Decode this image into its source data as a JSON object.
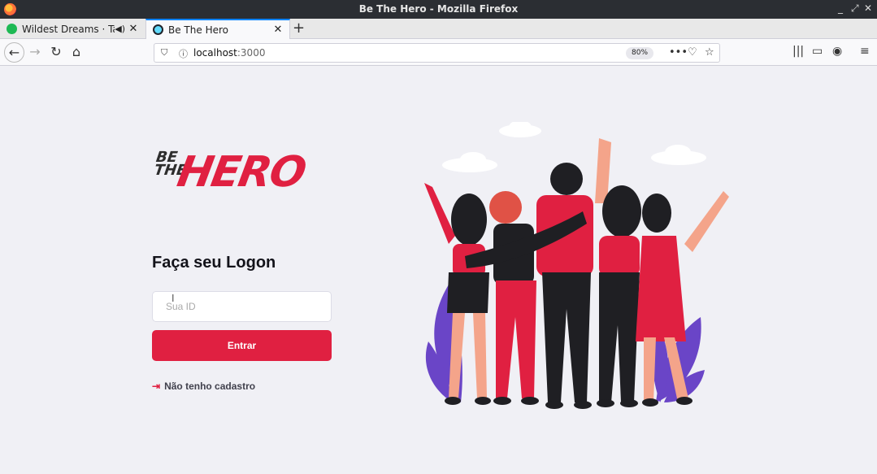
{
  "window": {
    "title": "Be The Hero - Mozilla Firefox"
  },
  "tabs": [
    {
      "label": "Wildest Dreams · Tayl",
      "favicon_color": "#1db954"
    },
    {
      "label": "Be The Hero",
      "favicon_color": "#61dafb"
    }
  ],
  "navbar": {
    "url_host": "localhost",
    "url_port": ":3000",
    "zoom": "80%"
  },
  "page": {
    "logo_top": "BE",
    "logo_bottom": "THE",
    "logo_main": "HERO",
    "heading": "Faça seu Logon",
    "input_placeholder": "Sua ID",
    "submit_label": "Entrar",
    "register_link": "Não tenho cadastro"
  },
  "colors": {
    "accent": "#e02041",
    "background": "#f0f0f5"
  }
}
